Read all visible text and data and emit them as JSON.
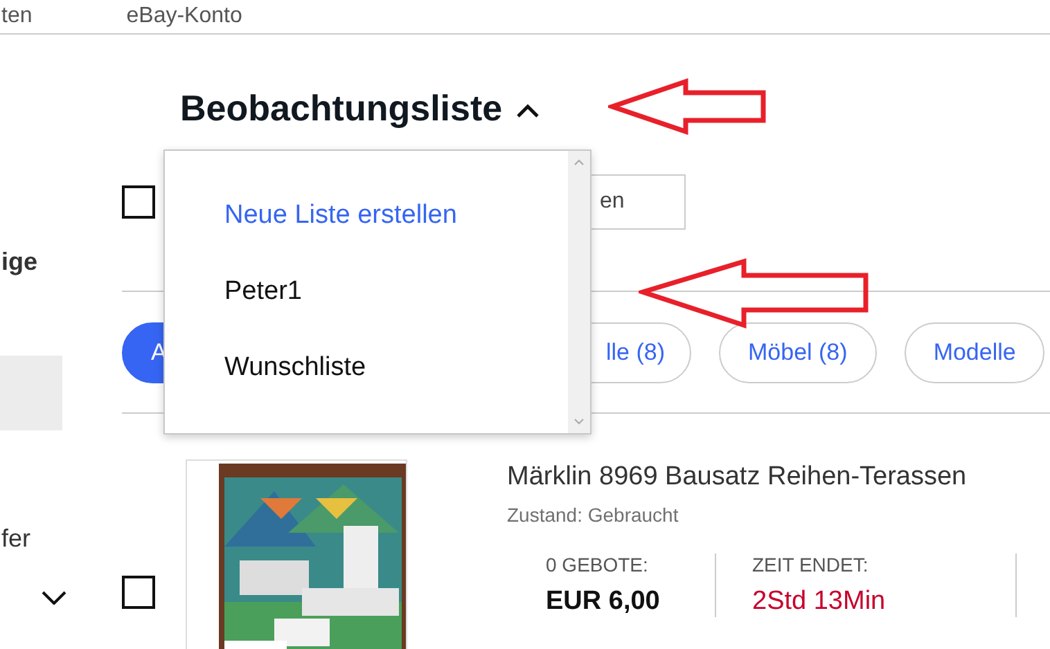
{
  "top_nav": [
    {
      "label": "ten"
    },
    {
      "label": "eBay-Konto"
    }
  ],
  "sidebar": {
    "labels": [
      "ige",
      "fer"
    ]
  },
  "title": "Beobachtungsliste",
  "list_menu": {
    "expanded": true,
    "items": [
      {
        "label": "Neue Liste erstellen",
        "kind": "action"
      },
      {
        "label": "Peter1",
        "kind": "list"
      },
      {
        "label": "Wunschliste",
        "kind": "list"
      }
    ]
  },
  "select_all": {
    "checked": false
  },
  "search": {
    "placeholder": "en"
  },
  "filters": [
    {
      "label": "A",
      "selected": true
    },
    {
      "label": "lle (8)",
      "selected": false
    },
    {
      "label": "Möbel (8)",
      "selected": false
    },
    {
      "label": "Modelle",
      "selected": false
    }
  ],
  "items": [
    {
      "checked": false,
      "image": {
        "kind": "picture"
      },
      "title": "Märklin 8969 Bausatz Reihen-Terassen",
      "condition": "Zustand: Gebraucht",
      "stats": [
        {
          "label": "0 GEBOTE:",
          "value": "EUR 6,00",
          "kind": "price"
        },
        {
          "label": "ZEIT ENDET:",
          "value": "2Std 13Min",
          "kind": "time"
        }
      ]
    }
  ]
}
